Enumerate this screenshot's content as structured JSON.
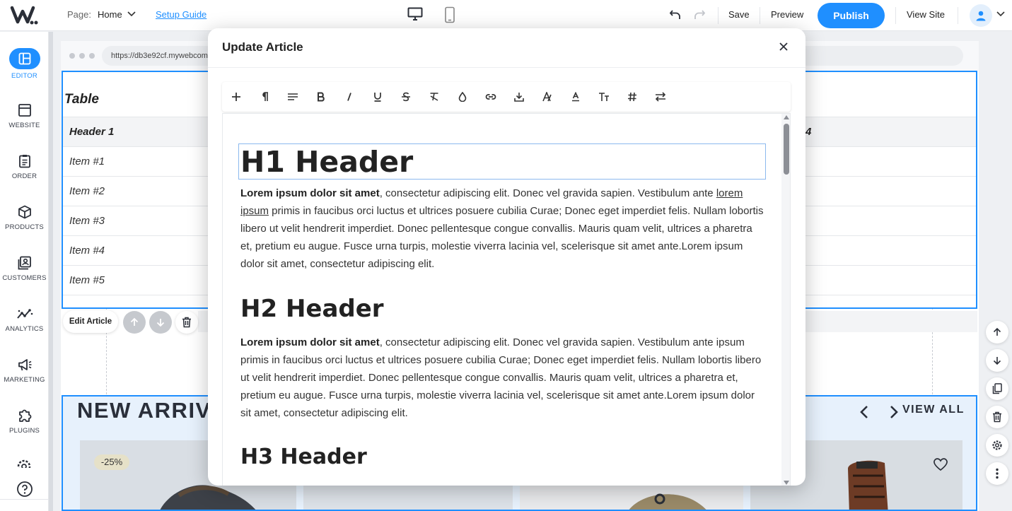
{
  "topbar": {
    "page_label": "Page:",
    "page_value": "Home",
    "setup_guide": "Setup Guide",
    "save": "Save",
    "preview": "Preview",
    "publish": "Publish",
    "view_site": "View Site"
  },
  "sidebar": {
    "items": [
      {
        "label": "EDITOR",
        "icon": "layout-icon"
      },
      {
        "label": "WEBSITE",
        "icon": "browser-icon"
      },
      {
        "label": "ORDER",
        "icon": "clipboard-icon"
      },
      {
        "label": "PRODUCTS",
        "icon": "box-icon"
      },
      {
        "label": "CUSTOMERS",
        "icon": "contacts-icon"
      },
      {
        "label": "ANALYTICS",
        "icon": "analytics-icon"
      },
      {
        "label": "MARKETING",
        "icon": "megaphone-icon"
      },
      {
        "label": "PLUGINS",
        "icon": "puzzle-icon"
      }
    ]
  },
  "canvas": {
    "url": "https://db3e92cf.mywebcom",
    "table_title": "Table",
    "table_header_left": "Header 1",
    "table_header_right": "4",
    "rows": [
      "Item #1",
      "Item #2",
      "Item #3",
      "Item #4",
      "Item #5"
    ],
    "edit_article": "Edit Article",
    "arrivals_title": "NEW ARRIV",
    "view_all": "VIEW ALL",
    "discount": "-25%"
  },
  "modal": {
    "title": "Update Article",
    "h1": "H1 Header",
    "h2": "H2 Header",
    "h3": "H3 Header",
    "para1": {
      "bold": "Lorem ipsum dolor sit amet",
      "text_a": ", consectetur adipiscing elit. Donec vel gravida sapien. Vestibulum ante ",
      "link": "lorem ipsum",
      "text_b": " primis in faucibus orci luctus et ultrices posuere cubilia Curae; Donec eget imperdiet felis. Nullam lobortis libero ut velit hendrerit imperdiet. Donec pellentesque congue convallis. Mauris quam velit, ultrices a pharetra et, pretium eu augue. Fusce urna turpis, molestie viverra lacinia vel, scelerisque sit amet ante.Lorem ipsum dolor sit amet, consectetur adipiscing elit."
    },
    "para2": {
      "bold": "Lorem ipsum dolor sit amet",
      "text": ", consectetur adipiscing elit. Donec vel gravida sapien. Vestibulum ante ipsum primis in faucibus orci luctus et ultrices posuere cubilia Curae; Donec eget imperdiet felis. Nullam lobortis libero ut velit hendrerit imperdiet. Donec pellentesque congue convallis. Mauris quam velit, ultrices a pharetra et, pretium eu augue. Fusce urna turpis, molestie viverra lacinia vel, scelerisque sit amet ante.Lorem ipsum dolor sit amet, consectetur adipiscing elit."
    },
    "toolbar_icons": [
      "plus-icon",
      "paragraph-icon",
      "align-icon",
      "bold-icon",
      "italic-icon",
      "underline-icon",
      "strikethrough-icon",
      "clear-format-icon",
      "color-drop-icon",
      "link-icon",
      "download-icon",
      "font-icon",
      "font-color-icon",
      "text-size-icon",
      "hash-icon",
      "swap-icon"
    ]
  },
  "colors": {
    "accent": "#1f8fff",
    "dark_text": "#222222"
  }
}
